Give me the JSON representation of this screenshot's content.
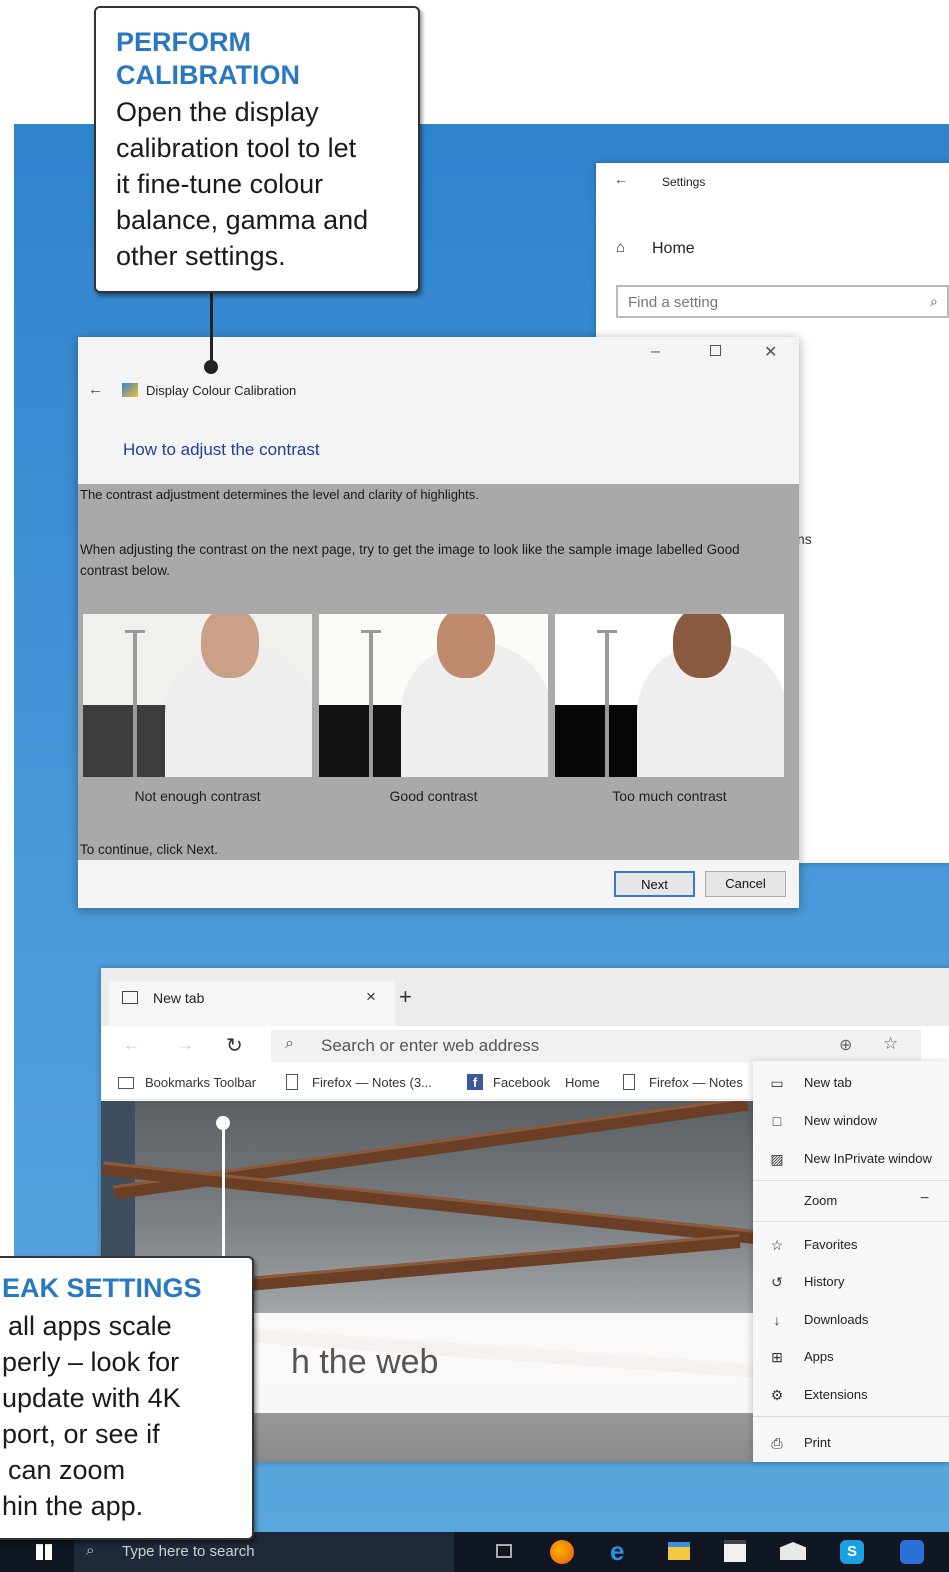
{
  "callout_top": {
    "heading": "PERFORM CALIBRATION",
    "lines": [
      "Open the display",
      "calibration tool to let",
      "it fine-tune colour",
      "balance, gamma and",
      "other settings."
    ]
  },
  "callout_bottom": {
    "heading": "EAK SETTINGS",
    "lines": [
      "all apps scale",
      "perly – look for",
      "update with 4K",
      "port, or see if",
      "can zoom",
      "hin the app."
    ]
  },
  "settings": {
    "title": "Settings",
    "home": "Home",
    "search_placeholder": "Find a setting",
    "partial_text": "ns"
  },
  "calibration": {
    "title": "Display Colour Calibration",
    "heading": "How to adjust the contrast",
    "para1": "The contrast adjustment determines the level and clarity of highlights.",
    "para2": "When adjusting the contrast on the next page, try to get the image to look like the sample image labelled Good contrast below.",
    "samples": [
      {
        "caption": "Not enough contrast",
        "dark": "#3c3c3c",
        "bright": "#f0f0ec",
        "face": "#caa088"
      },
      {
        "caption": "Good contrast",
        "dark": "#111111",
        "bright": "#fafaf6",
        "face": "#c08a6c"
      },
      {
        "caption": "Too much contrast",
        "dark": "#060606",
        "bright": "#ffffff",
        "face": "#8a5a40"
      }
    ],
    "continue_text": "To continue, click Next.",
    "next_label": "Next",
    "cancel_label": "Cancel"
  },
  "browser": {
    "tab_label": "New tab",
    "address_placeholder": "Search or enter web address",
    "bookmarks": [
      "Bookmarks Toolbar",
      "Firefox — Notes (3...",
      "Facebook",
      "Home",
      "Firefox — Notes"
    ],
    "search_partial": "h the web",
    "menu": [
      {
        "icon": "new-tab-icon",
        "glyph": "▭",
        "label": "New tab"
      },
      {
        "icon": "new-window-icon",
        "glyph": "□",
        "label": "New window"
      },
      {
        "icon": "inprivate-icon",
        "glyph": "▨",
        "label": "New InPrivate window"
      },
      {
        "icon": "zoom-icon",
        "glyph": "",
        "label": "Zoom"
      },
      {
        "icon": "favorites-icon",
        "glyph": "☆",
        "label": "Favorites"
      },
      {
        "icon": "history-icon",
        "glyph": "↺",
        "label": "History"
      },
      {
        "icon": "downloads-icon",
        "glyph": "↓",
        "label": "Downloads"
      },
      {
        "icon": "apps-icon",
        "glyph": "⊞",
        "label": "Apps"
      },
      {
        "icon": "extensions-icon",
        "glyph": "⚙",
        "label": "Extensions"
      },
      {
        "icon": "print-icon",
        "glyph": "⎙",
        "label": "Print"
      }
    ]
  },
  "taskbar": {
    "search_placeholder": "Type here to search"
  },
  "colors": {
    "accent": "#2a78c0",
    "desktop": "#3a8fd3",
    "taskbar": "#101723"
  }
}
